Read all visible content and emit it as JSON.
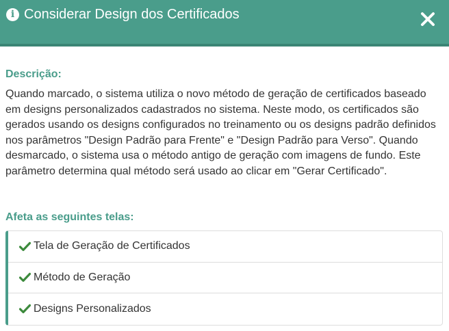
{
  "dialog": {
    "title": "Considerar Design dos Certificados",
    "icons": {
      "title": "info-icon",
      "close": "close-icon",
      "item": "check-icon"
    },
    "colors": {
      "accent": "#4a9d8b",
      "check": "#3c8a3c"
    }
  },
  "description": {
    "heading": "Descrição:",
    "text": "Quando marcado, o sistema utiliza o novo método de geração de certificados baseado em designs personalizados cadastrados no sistema. Neste modo, os certificados são gerados usando os designs configurados no treinamento ou os designs padrão definidos nos parâmetros \"Design Padrão para Frente\" e \"Design Padrão para Verso\". Quando desmarcado, o sistema usa o método antigo de geração com imagens de fundo. Este parâmetro determina qual método será usado ao clicar em \"Gerar Certificado\"."
  },
  "affects": {
    "heading": "Afeta as seguintes telas:",
    "items": [
      {
        "label": "Tela de Geração de Certificados"
      },
      {
        "label": "Método de Geração"
      },
      {
        "label": "Designs Personalizados"
      }
    ]
  }
}
